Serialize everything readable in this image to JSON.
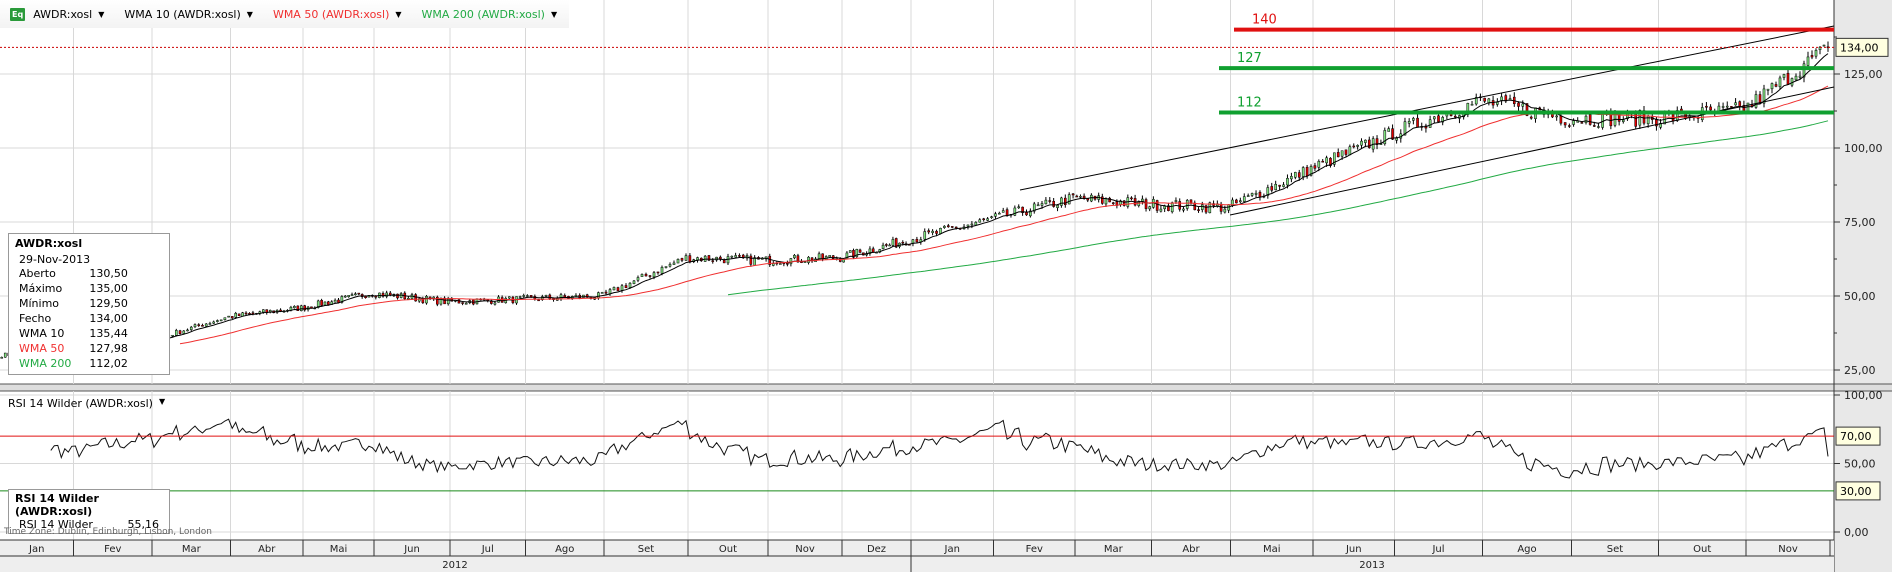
{
  "legend": {
    "symbol": "AWDR:xosl",
    "wma10": "WMA 10 (AWDR:xosl)",
    "wma50": "WMA 50 (AWDR:xosl)",
    "wma200": "WMA 200 (AWDR:xosl)",
    "eq_icon": "Eq"
  },
  "info": {
    "title": "AWDR:xosl",
    "date": "29-Nov-2013",
    "rows": [
      {
        "label": "Aberto",
        "value": "130,50"
      },
      {
        "label": "Máximo",
        "value": "135,00"
      },
      {
        "label": "Mínimo",
        "value": "129,50"
      },
      {
        "label": "Fecho",
        "value": "134,00"
      },
      {
        "label": "WMA 10",
        "value": "135,44"
      },
      {
        "label": "WMA 50",
        "value": "127,98"
      },
      {
        "label": "WMA 200",
        "value": "112,02"
      }
    ]
  },
  "rsi": {
    "header": "RSI 14 Wilder (AWDR:xosl)",
    "box_title": "RSI 14 Wilder (AWDR:xosl)",
    "box_label": "RSI 14 Wilder",
    "box_value": "55,16"
  },
  "timezone": "Time Zone: Dublin, Edinburgh, Lisbon, London",
  "colors": {
    "up": "#7fe07f",
    "down": "#e00000",
    "wma10": "#000000",
    "wma50": "#f03030",
    "wma200": "#22aa44",
    "red_line": "#e01010",
    "green_line": "#10a030"
  },
  "chart_data": {
    "type": "candlestick",
    "months": [
      "Jan",
      "Fev",
      "Mar",
      "Abr",
      "Mai",
      "Jun",
      "Jul",
      "Ago",
      "Set",
      "Out",
      "Nov",
      "Dez",
      "Jan",
      "Fev",
      "Mar",
      "Abr",
      "Mai",
      "Jun",
      "Jul",
      "Ago",
      "Set",
      "Out",
      "Nov"
    ],
    "years": [
      "2012",
      "2013"
    ],
    "monthly_close": [
      31,
      35,
      43,
      46,
      51,
      48,
      49,
      50,
      63,
      62,
      63,
      69,
      76,
      83,
      81,
      80,
      93,
      105,
      116,
      110,
      110,
      113,
      134
    ],
    "last_close": 134,
    "price_axis": {
      "ticks": [
        "25,00",
        "50,00",
        "75,00",
        "100,00",
        "125,00"
      ],
      "values": [
        25,
        50,
        75,
        100,
        125
      ],
      "range": [
        20,
        150
      ]
    },
    "rsi_axis": {
      "ticks": [
        "0,00",
        "50,00",
        "100,00"
      ],
      "values": [
        0,
        50,
        100
      ],
      "range": [
        -10,
        100
      ]
    },
    "horizontal_levels": [
      {
        "value": 140,
        "label": "140",
        "color": "red"
      },
      {
        "value": 127,
        "label": "127",
        "color": "green"
      },
      {
        "value": 112,
        "label": "112",
        "color": "green"
      }
    ],
    "rsi_levels": [
      {
        "value": 70,
        "label": "70,00"
      },
      {
        "value": 30,
        "label": "30,00"
      }
    ],
    "price_tag": "134,00"
  }
}
